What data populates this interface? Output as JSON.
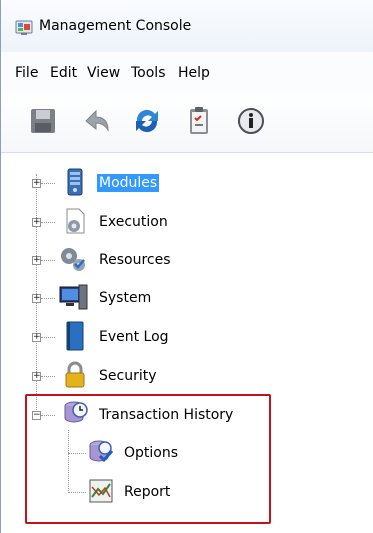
{
  "window": {
    "title": "Management Console",
    "title_icon": "console-app-icon"
  },
  "menu": {
    "items": [
      "File",
      "Edit",
      "View",
      "Tools",
      "Help"
    ]
  },
  "toolbar": {
    "buttons": [
      "save-icon",
      "undo-icon",
      "refresh-icon",
      "clipboard-icon",
      "info-icon"
    ]
  },
  "tree": {
    "nodes": [
      {
        "label": "Modules",
        "icon": "server-icon",
        "selected": true,
        "expander": "+"
      },
      {
        "label": "Execution",
        "icon": "gear-document-icon",
        "expander": "+"
      },
      {
        "label": "Resources",
        "icon": "gears-icon",
        "expander": "+"
      },
      {
        "label": "System",
        "icon": "computer-icon",
        "expander": "+"
      },
      {
        "label": "Event Log",
        "icon": "book-icon",
        "expander": "+"
      },
      {
        "label": "Security",
        "icon": "padlock-icon",
        "expander": "+"
      },
      {
        "label": "Transaction History",
        "icon": "clock-database-icon",
        "expander": "−",
        "children": [
          {
            "label": "Options",
            "icon": "options-icon"
          },
          {
            "label": "Report",
            "icon": "report-chart-icon"
          }
        ]
      }
    ]
  },
  "colors": {
    "highlight": "#c0141a",
    "selection": "#3399ff"
  }
}
